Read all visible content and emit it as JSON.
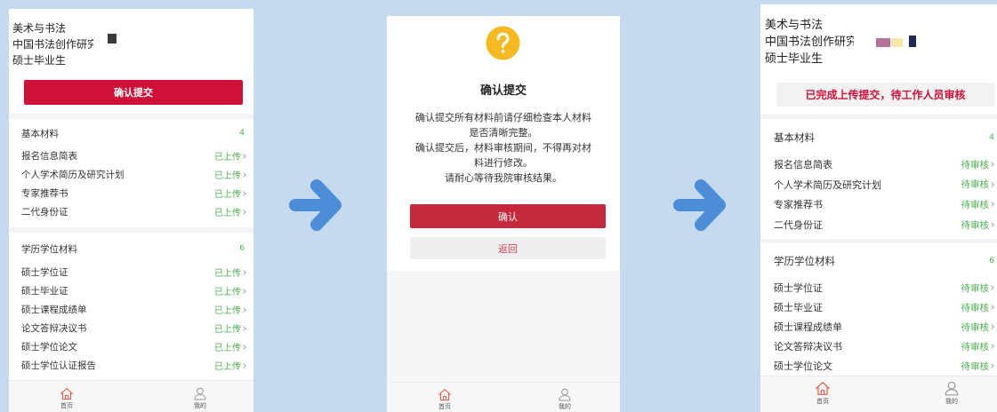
{
  "colors": {
    "page_bg": "#c6daef",
    "arrow": "#4b8dd6",
    "primary_red": "#cf1039",
    "confirm_red": "#c6283d",
    "back_text": "#d9424f",
    "status_green": "#4cae50",
    "question_yellow": "#f5b921",
    "tab_active": "#e0604f",
    "tab_inactive": "#9a9a9a"
  },
  "icons": {
    "flow_arrow": "arrow-right-icon",
    "dialog": "question-mark-icon",
    "row_chevron": "chevron-right-icon",
    "tab_home": "home-icon",
    "tab_mine": "user-icon"
  },
  "screen_before": {
    "profile": {
      "line1": "美术与书法",
      "line2": "中国书法创作研究",
      "line3": "硕士毕业生"
    },
    "submit_button": "确认提交",
    "sections": [
      {
        "title": "基本材料",
        "count": "4",
        "items": [
          {
            "label": "报名信息简表",
            "status": "已上传"
          },
          {
            "label": "个人学术简历及研究计划",
            "status": "已上传"
          },
          {
            "label": "专家推荐书",
            "status": "已上传"
          },
          {
            "label": "二代身份证",
            "status": "已上传"
          }
        ]
      },
      {
        "title": "学历学位材料",
        "count": "6",
        "items": [
          {
            "label": "硕士学位证",
            "status": "已上传"
          },
          {
            "label": "硕士毕业证",
            "status": "已上传"
          },
          {
            "label": "硕士课程成绩单",
            "status": "已上传"
          },
          {
            "label": "论文答辩决议书",
            "status": "已上传"
          },
          {
            "label": "硕士学位论文",
            "status": "已上传"
          },
          {
            "label": "硕士学位认证报告",
            "status": "已上传"
          }
        ]
      }
    ],
    "tabbar": {
      "home": "首页",
      "mine": "我的"
    }
  },
  "screen_dialog": {
    "title": "确认提交",
    "message_lines": [
      "确认提交所有材料前请仔细检查本人材料",
      "是否清晰完整。",
      "确认提交后，材料审核期间，不得再对材",
      "料进行修改。",
      "请耐心等待我院审核结果。"
    ],
    "confirm_button": "确认",
    "back_button": "返回",
    "tabbar": {
      "home": "首页",
      "mine": "我的"
    }
  },
  "screen_after": {
    "profile": {
      "line1": "美术与书法",
      "line2": "中国书法创作研究",
      "line3": "硕士毕业生"
    },
    "status_banner": "已完成上传提交，待工作人员审核",
    "sections": [
      {
        "title": "基本材料",
        "count": "4",
        "items": [
          {
            "label": "报名信息简表",
            "status": "待审核"
          },
          {
            "label": "个人学术简历及研究计划",
            "status": "待审核"
          },
          {
            "label": "专家推荐书",
            "status": "待审核"
          },
          {
            "label": "二代身份证",
            "status": "待审核"
          }
        ]
      },
      {
        "title": "学历学位材料",
        "count": "6",
        "items": [
          {
            "label": "硕士学位证",
            "status": "待审核"
          },
          {
            "label": "硕士毕业证",
            "status": "待审核"
          },
          {
            "label": "硕士课程成绩单",
            "status": "待审核"
          },
          {
            "label": "论文答辩决议书",
            "status": "待审核"
          },
          {
            "label": "硕士学位论文",
            "status": "待审核"
          }
        ]
      }
    ],
    "tabbar": {
      "home": "首页",
      "mine": "我的"
    }
  }
}
